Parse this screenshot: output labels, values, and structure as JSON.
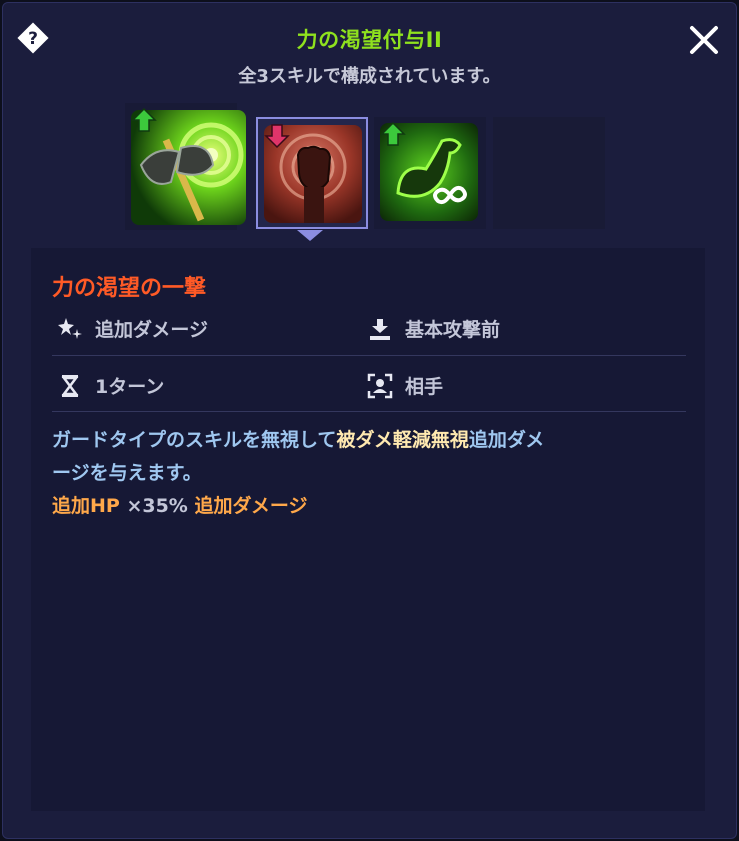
{
  "header": {
    "title": "力の渇望付与II",
    "subtitle": "全3スキルで構成されています。"
  },
  "skills": [
    {
      "name": "axe-skill",
      "badge": "up",
      "selected": false
    },
    {
      "name": "fist-skill",
      "badge": "down",
      "selected": true
    },
    {
      "name": "arm-skill",
      "badge": "up",
      "selected": false
    },
    {
      "name": "empty",
      "badge": "",
      "selected": false
    }
  ],
  "detail": {
    "skill_name": "力の渇望の一撃",
    "attributes": {
      "effect": "追加ダメージ",
      "timing": "基本攻撃前",
      "duration": "1ターン",
      "target": "相手"
    },
    "description": {
      "part1": "ガードタイプのスキルを無視して",
      "highlight": "被ダメ軽減無視",
      "part2a": "追加ダメ",
      "part2b": "ージを与えます。",
      "bonus_label": "追加HP",
      "bonus_mult": " ×35% ",
      "bonus_effect": "追加ダメージ"
    }
  },
  "colors": {
    "title": "#8fe21e",
    "skill_name": "#ff5a26",
    "description": "#9fc7f0",
    "highlight": "#ffe9b0",
    "bonus": "#ffa84a"
  }
}
